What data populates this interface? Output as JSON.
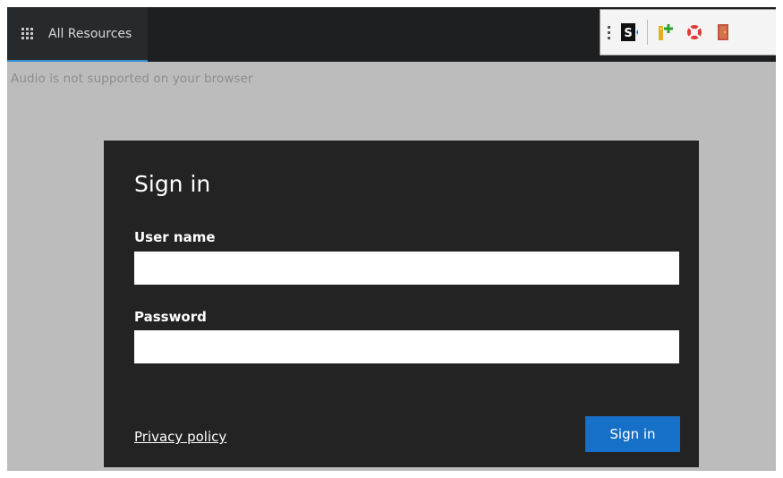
{
  "topbar": {
    "all_resources_label": "All Resources"
  },
  "toolbar": {
    "buttons": [
      {
        "icon": "switch-app-icon"
      },
      {
        "icon": "keyboard-icon"
      },
      {
        "icon": "help-icon"
      },
      {
        "icon": "disconnect-icon"
      }
    ]
  },
  "notice": {
    "audio_message": "Audio is not supported on your browser"
  },
  "signin": {
    "title": "Sign in",
    "username_label": "User name",
    "username_value": "",
    "password_label": "Password",
    "password_value": "",
    "privacy_link": "Privacy policy",
    "submit_label": "Sign in"
  },
  "colors": {
    "accent": "#1670c8",
    "card_bg": "#232323",
    "topbar_bg": "#1e1f20",
    "page_bg": "#bcbcbc"
  }
}
